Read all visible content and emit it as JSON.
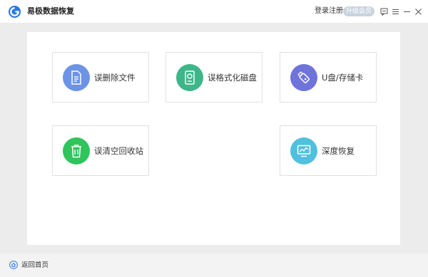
{
  "app": {
    "title": "易极数据恢复",
    "logo_icon": "recovery-logo-icon",
    "brand_color": "#2a7ae2"
  },
  "header": {
    "login_label": "登录注册",
    "upgrade_label": "升级会员",
    "icons": [
      "feedback-icon",
      "menu-icon",
      "minimize-icon",
      "close-icon"
    ]
  },
  "options": [
    {
      "label": "误删除文件",
      "icon": "document-icon",
      "color": "#6c93e6"
    },
    {
      "label": "误格式化磁盘",
      "icon": "disk-icon",
      "color": "#3fb58a"
    },
    {
      "label": "U盘/存储卡",
      "icon": "usb-icon",
      "color": "#6e74d9"
    },
    {
      "label": "误清空回收站",
      "icon": "trash-icon",
      "color": "#2fc45c"
    },
    {
      "label": "深度恢复",
      "icon": "monitor-chart-icon",
      "color": "#4fc0dd"
    }
  ],
  "footer": {
    "home_label": "返回首页",
    "home_icon": "home-icon"
  }
}
